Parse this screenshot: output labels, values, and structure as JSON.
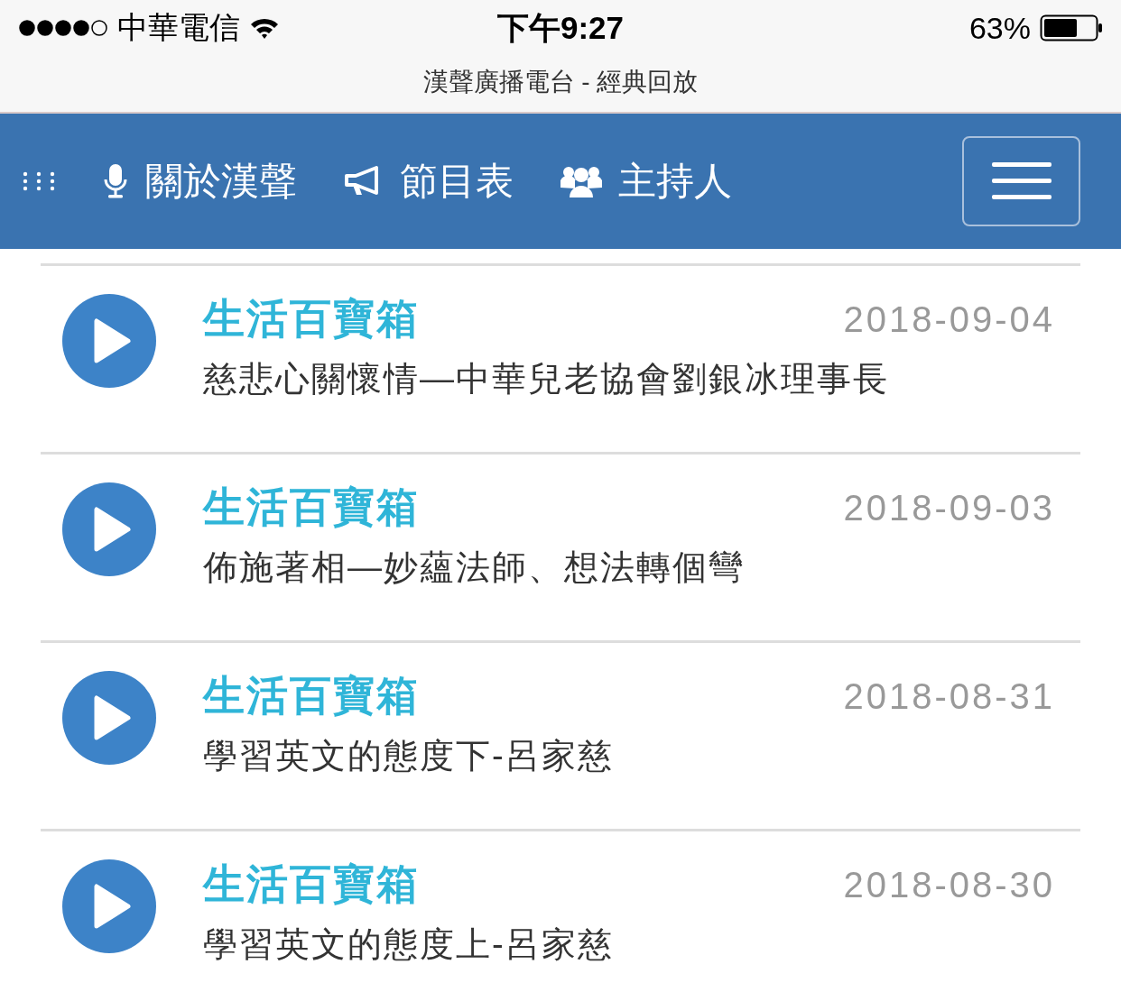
{
  "status_bar": {
    "carrier": "中華電信",
    "time": "下午9:27",
    "battery": "63%"
  },
  "page_title": "漢聲廣播電台 - 經典回放",
  "nav": {
    "items": [
      {
        "label": "關於漢聲",
        "kind": "microphone"
      },
      {
        "label": "節目表",
        "kind": "bullhorn"
      },
      {
        "label": "主持人",
        "kind": "users"
      }
    ]
  },
  "episodes": [
    {
      "program": "生活百寶箱",
      "date": "2018-09-04",
      "title": "慈悲心關懷情—中華兒老協會劉銀冰理事長"
    },
    {
      "program": "生活百寶箱",
      "date": "2018-09-03",
      "title": "佈施著相—妙蘊法師、想法轉個彎"
    },
    {
      "program": "生活百寶箱",
      "date": "2018-08-31",
      "title": "學習英文的態度下-呂家慈"
    },
    {
      "program": "生活百寶箱",
      "date": "2018-08-30",
      "title": "學習英文的態度上-呂家慈"
    }
  ]
}
